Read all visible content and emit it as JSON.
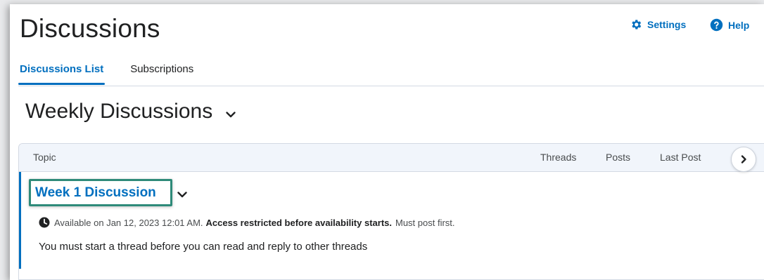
{
  "header": {
    "title": "Discussions",
    "settings_label": "Settings",
    "help_label": "Help"
  },
  "tabs": [
    {
      "label": "Discussions List",
      "active": true
    },
    {
      "label": "Subscriptions",
      "active": false
    }
  ],
  "forum": {
    "title": "Weekly Discussions"
  },
  "table": {
    "columns": {
      "topic": "Topic",
      "threads": "Threads",
      "posts": "Posts",
      "last_post": "Last Post"
    },
    "rows": [
      {
        "title": "Week 1 Discussion",
        "availability": "Available on Jan 12, 2023 12:01 AM.",
        "restriction": "Access restricted before availability starts.",
        "post_requirement": "Must post first.",
        "description": "You must start a thread before you can read and reply to other threads"
      }
    ]
  },
  "icons": {
    "settings": "gear-icon",
    "help": "question-circle-icon",
    "forum_menu": "chevron-down-icon",
    "topic_menu": "chevron-down-icon",
    "availability": "clock-icon",
    "scroll": "chevron-right-icon"
  },
  "colors": {
    "accent": "#006fbf",
    "highlight_box": "#2e8a79",
    "header_bg": "#f1f5fb"
  }
}
